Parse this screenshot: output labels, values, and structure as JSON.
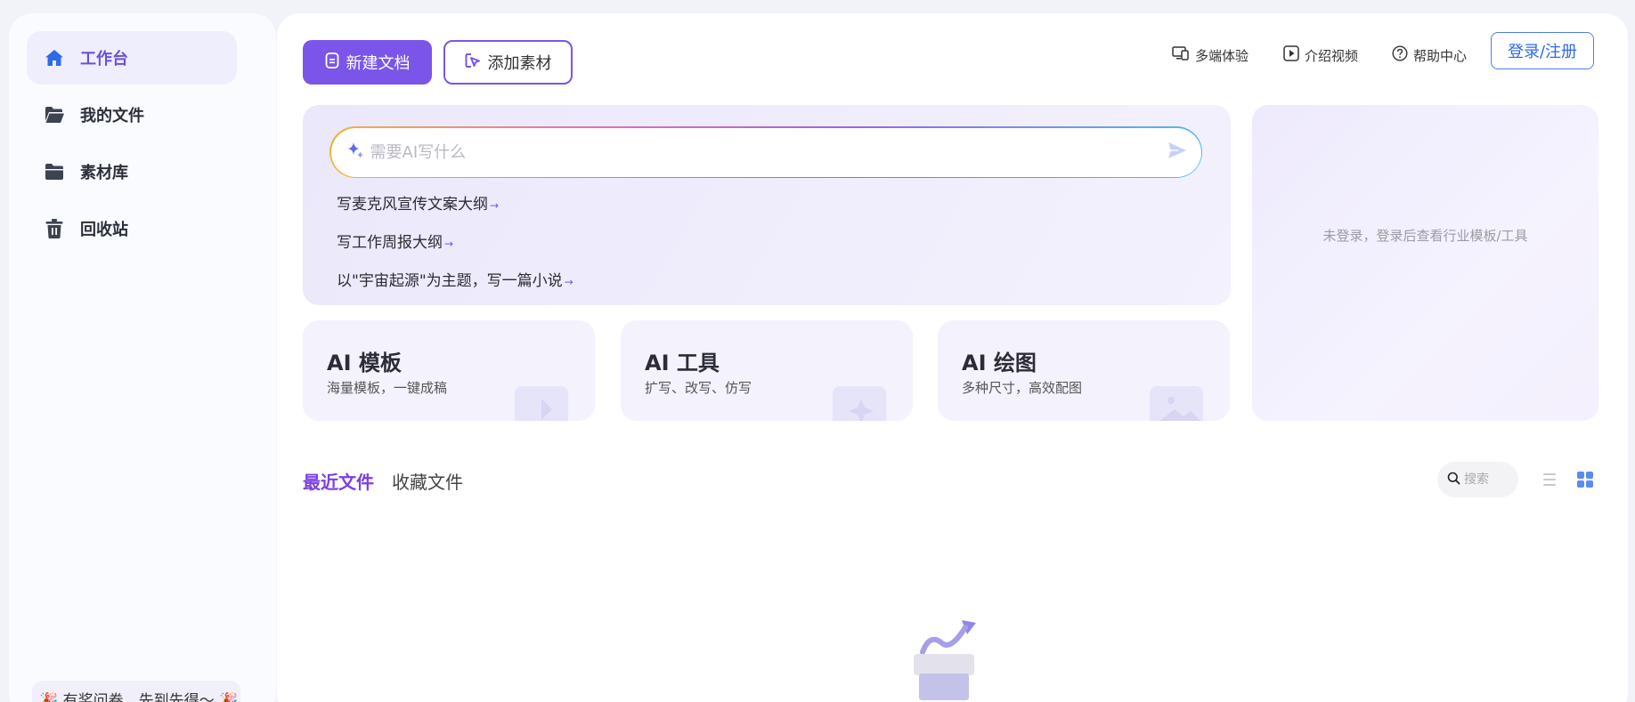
{
  "sidebar": {
    "items": [
      {
        "label": "工作台",
        "icon": "home-icon",
        "active": true
      },
      {
        "label": "我的文件",
        "icon": "folder-open-icon",
        "active": false
      },
      {
        "label": "素材库",
        "icon": "folder-icon",
        "active": false
      },
      {
        "label": "回收站",
        "icon": "trash-icon",
        "active": false
      }
    ],
    "promo": "🎉 有奖问卷，先到先得～ 🎉"
  },
  "toolbar": {
    "new_doc": "新建文档",
    "add_material": "添加素材"
  },
  "header_links": [
    {
      "label": "多端体验",
      "icon": "devices-icon"
    },
    {
      "label": "介绍视频",
      "icon": "play-icon"
    },
    {
      "label": "帮助中心",
      "icon": "help-icon"
    }
  ],
  "login": "登录/注册",
  "ai_prompt": {
    "placeholder": "需要AI写什么",
    "suggestions": [
      "写麦克风宣传文案大纲",
      "写工作周报大纲",
      "以\"宇宙起源\"为主题，写一篇小说"
    ]
  },
  "cards": [
    {
      "title": "AI 模板",
      "desc": "海量模板，一键成稿"
    },
    {
      "title": "AI 工具",
      "desc": "扩写、改写、仿写"
    },
    {
      "title": "AI 绘图",
      "desc": "多种尺寸，高效配图"
    }
  ],
  "right_panel": {
    "message": "未登录，登录后查看行业模板/工具"
  },
  "files": {
    "tabs": [
      "最近文件",
      "收藏文件"
    ],
    "search_placeholder": "搜索"
  },
  "colors": {
    "accent": "#7b55ea",
    "login_blue": "#2f6ae8",
    "active_bg": "#efeefd"
  }
}
